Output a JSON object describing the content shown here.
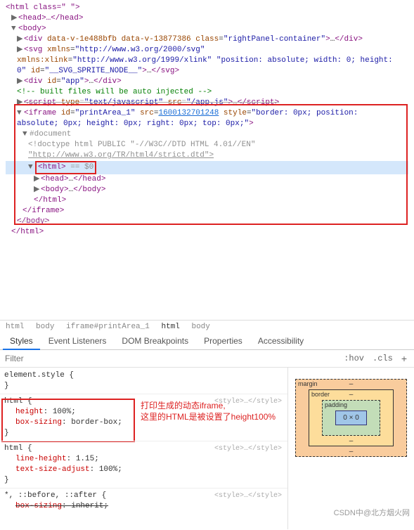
{
  "elements": {
    "html_open": "<html class=\" \">",
    "head": "<head>…</head>",
    "body_open": "<body>",
    "div_rightpanel": "<div data-v-1e488bfb data-v-13877386 class=\"rightPanel-container\">…</div>",
    "svg_line": "<svg xmlns=\"http://www.w3.org/2000/svg\" xmlns:xlink=\"http://www.w3.org/1999/xlink\" \"position: absolute; width: 0; height: 0\" id=\"__SVG_SPRITE_NODE__\">…</svg>",
    "div_app": "<div id=\"app\">…</div>",
    "comment_built": "<!-- built files will be auto injected -->",
    "script_app": "<script type=\"text/javascript\" src=\"/app.js\">…</script>",
    "iframe_open": "<iframe id=\"printArea_1\" src=\"1600132701248\" style=\"border: 0px; position: absolute; 0px; height: 0px; right: 0px; top: 0px;\">",
    "iframe_src": "1600132701248",
    "document": "#document",
    "doctype": "<!doctype html PUBLIC \"-//W3C//DTD HTML 4.01//EN\"",
    "doctype_url": "\"http://www.w3.org/TR/html4/strict.dtd\">",
    "inner_html": "<html>",
    "eq0": " == $0",
    "inner_head": "<head>…</head>",
    "inner_body": "<body>…</body>",
    "close_html": "</html>",
    "close_iframe": "</iframe>",
    "close_body": "</body>",
    "close_html2": "</html>"
  },
  "breadcrumb": [
    "html",
    "body",
    "iframe#printArea_1",
    "html",
    "body"
  ],
  "tabs": [
    "Styles",
    "Event Listeners",
    "DOM Breakpoints",
    "Properties",
    "Accessibility"
  ],
  "filter": {
    "placeholder": "Filter",
    "hov": ":hov",
    "cls": ".cls"
  },
  "styles": {
    "element_style": "element.style {",
    "brace": "}",
    "html_sel": "html {",
    "height": {
      "n": "height",
      "v": "100%;"
    },
    "boxsizing": {
      "n": "box-sizing",
      "v": "border-box;"
    },
    "lineheight": {
      "n": "line-height",
      "v": "1.15;"
    },
    "textsize": {
      "n": "text-size-adjust",
      "v": "100%;"
    },
    "star_sel": "*, ::before, ::after {",
    "boxsizing_inherit": {
      "n": "box-sizing",
      "v": "inherit;"
    },
    "origin": "<style>…</style>"
  },
  "boxmodel": {
    "margin": "margin",
    "border": "border",
    "padding": "padding",
    "content": "0 × 0",
    "dash": "–"
  },
  "annotation": {
    "l1": "打印生成的动态iframe,",
    "l2": "这里的HTML是被设置了height100%"
  },
  "watermark": "CSDN中@北方烟火网"
}
